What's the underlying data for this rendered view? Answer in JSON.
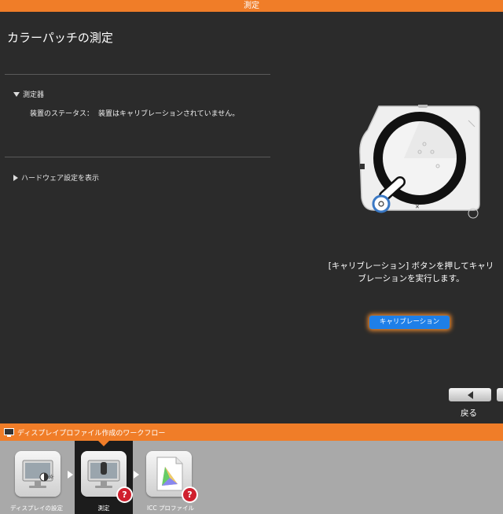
{
  "window": {
    "title": "測定"
  },
  "page": {
    "title": "カラーパッチの測定"
  },
  "device_section": {
    "header": "測定器",
    "status_label": "装置のステータス：",
    "status_value": "装置はキャリブレーションされていません。"
  },
  "hardware_section": {
    "header": "ハードウェア設定を表示"
  },
  "instruction": {
    "line1": "[キャリブレーション] ボタンを押してキャリ",
    "line2": "ブレーションを実行します。"
  },
  "buttons": {
    "calibration": "キャリブレーション",
    "back": "戻る"
  },
  "workflow": {
    "title": "ディスプレイプロファイル作成のワークフロー",
    "steps": [
      {
        "label": "ディスプレイの設定",
        "icon": "display-settings-icon",
        "active": false,
        "badge": ""
      },
      {
        "label": "測定",
        "icon": "measurement-icon",
        "active": true,
        "badge": "?"
      },
      {
        "label": "ICC プロファイル",
        "icon": "icc-profile-icon",
        "active": false,
        "badge": "?"
      }
    ]
  },
  "colors": {
    "accent": "#f07d28",
    "background": "#2b2b2b",
    "calibration_button": "#1e7fe8",
    "badge": "#d0202e"
  }
}
